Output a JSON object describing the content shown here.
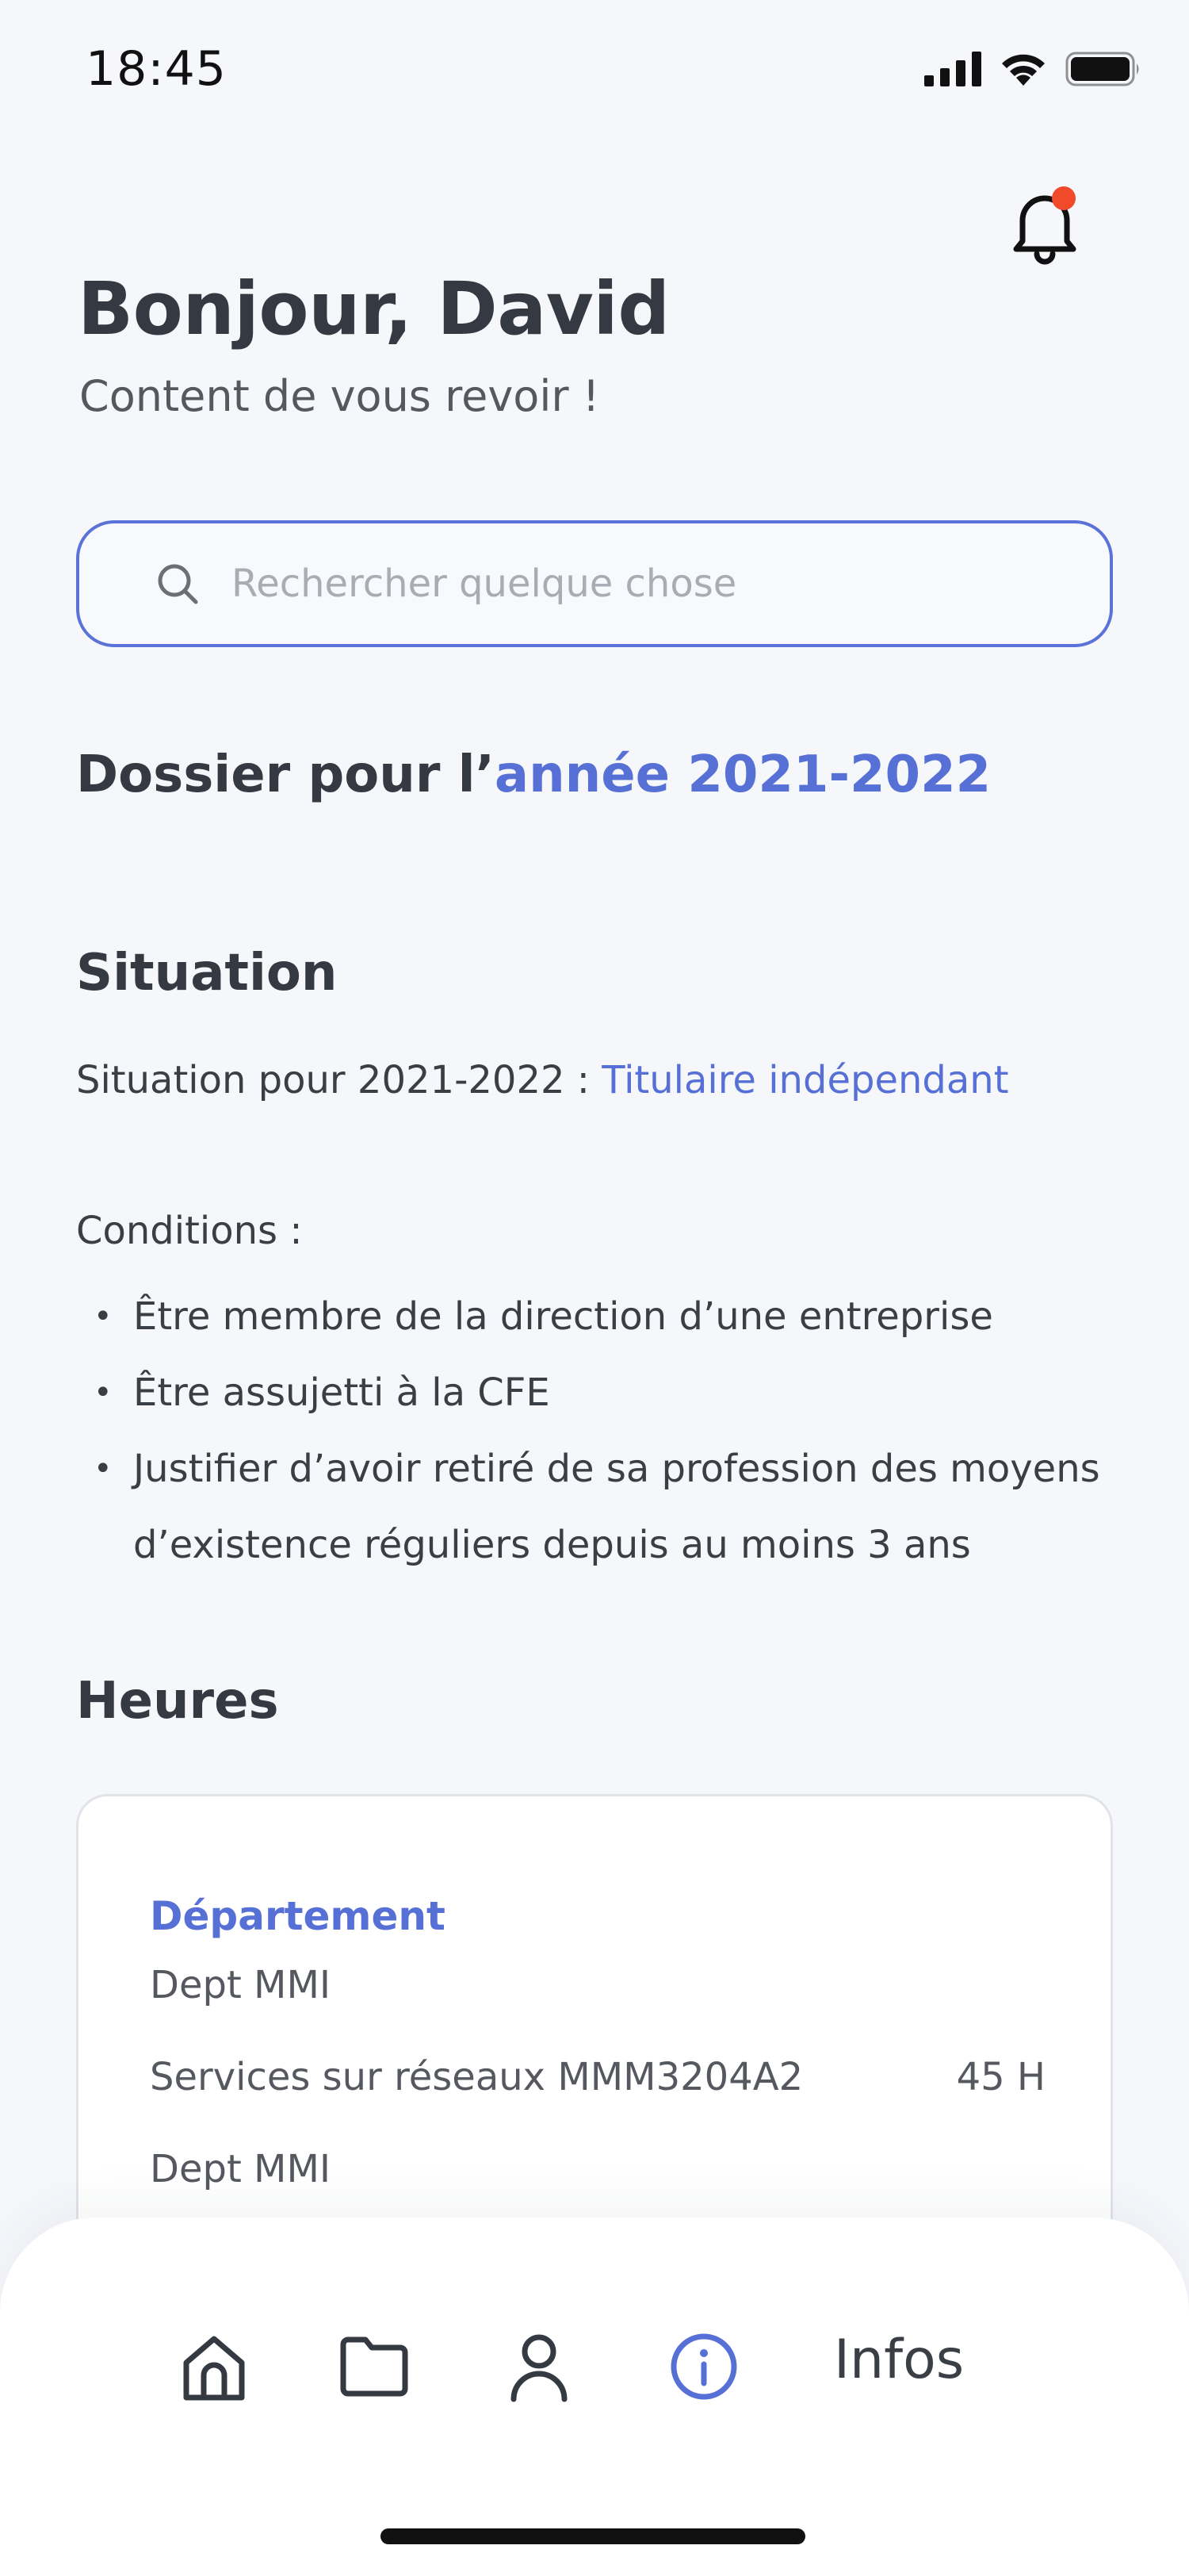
{
  "status_bar": {
    "time": "18:45"
  },
  "header": {
    "greeting": "Bonjour, David",
    "subtitle": "Content de vous revoir !"
  },
  "search": {
    "placeholder": "Rechercher quelque chose"
  },
  "dossier": {
    "prefix": "Dossier pour l’",
    "year": "année 2021-2022"
  },
  "situation": {
    "title": "Situation",
    "label": "Situation pour 2021-2022 : ",
    "value": "Titulaire indépendant",
    "conditions_label": "Conditions :",
    "conditions": [
      "Être membre de la direction d’une entreprise",
      "Être assujetti à la CFE",
      "Justifier d’avoir retiré de sa profession des moyens d’existence réguliers depuis au moins 3 ans"
    ]
  },
  "hours": {
    "title": "Heures",
    "card": {
      "heading": "Département",
      "dept_1": "Dept MMI",
      "course": "Services sur réseaux MMM3204A2",
      "course_hours": "45 H",
      "dept_2": "Dept MMI"
    }
  },
  "bottom_nav": {
    "items": [
      {
        "icon": "home-icon"
      },
      {
        "icon": "folder-icon"
      },
      {
        "icon": "user-icon"
      },
      {
        "icon": "info-icon",
        "label": "Infos",
        "active": true
      }
    ],
    "active_color": "#5670d6"
  },
  "colors": {
    "accent": "#5670d6",
    "notification": "#f04a2b",
    "background": "#f6f7fb"
  }
}
